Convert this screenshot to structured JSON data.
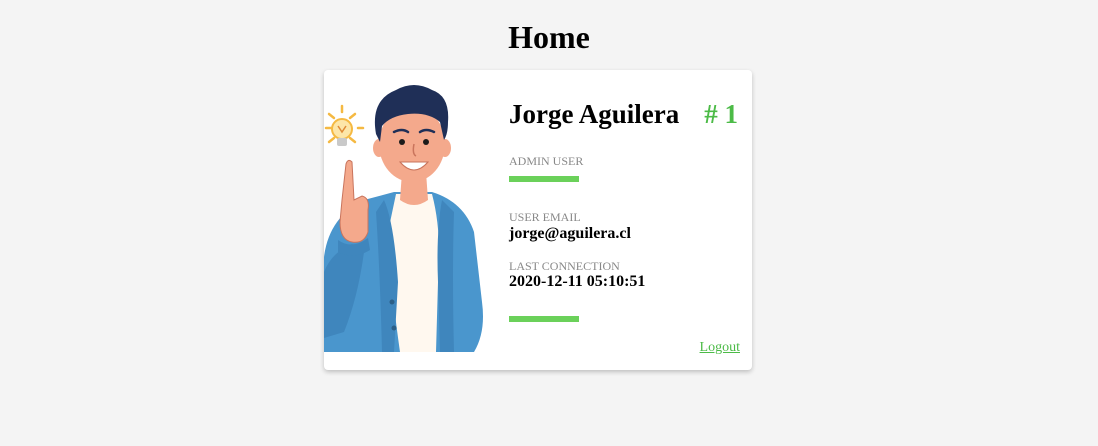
{
  "page": {
    "title": "Home"
  },
  "profile": {
    "name": "Jorge Aguilera",
    "rank": "# 1",
    "role": "ADMIN USER",
    "email_label": "USER EMAIL",
    "email": "jorge@aguilera.cl",
    "last_connection_label": "LAST CONNECTION",
    "last_connection": "2020-12-11 05:10:51",
    "avatar_icon": "man-pointing-up-with-lightbulb-illustration"
  },
  "actions": {
    "logout_label": "Logout"
  },
  "colors": {
    "accent": "#4cbb47",
    "bar": "#6bd15a",
    "label": "#888888",
    "background": "#f4f4f4",
    "card": "#ffffff"
  }
}
